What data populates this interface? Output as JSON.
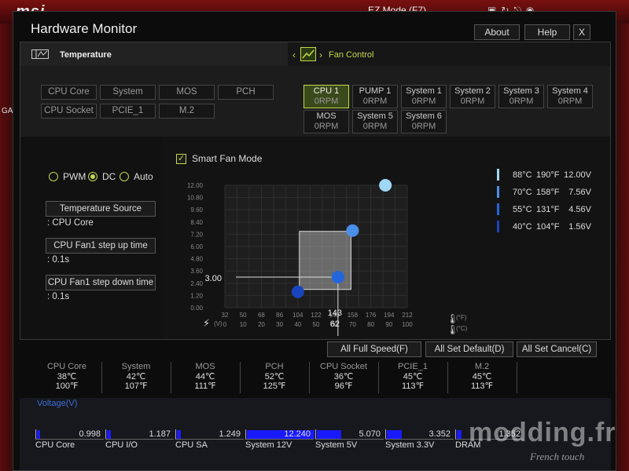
{
  "background": {
    "logo": "msi",
    "ez_mode": "EZ Mode (F7)",
    "side_label": "GA",
    "icons": [
      "f12-icon",
      "refresh-icon",
      "exit-icon",
      "language-icon"
    ]
  },
  "window": {
    "title": "Hardware Monitor",
    "buttons": [
      "About",
      "Help",
      "X"
    ]
  },
  "temperature_header": "Temperature",
  "fan_control_header": "Fan Control",
  "sensors": [
    {
      "label": "CPU Core",
      "active": true
    },
    {
      "label": "System",
      "active": false
    },
    {
      "label": "MOS",
      "active": false
    },
    {
      "label": "PCH",
      "active": false
    },
    {
      "label": "CPU Socket",
      "active": false
    },
    {
      "label": "PCIE_1",
      "active": false
    },
    {
      "label": "M.2",
      "active": false
    }
  ],
  "fans": [
    {
      "name": "CPU 1",
      "rpm": "0RPM",
      "active": true
    },
    {
      "name": "PUMP 1",
      "rpm": "0RPM",
      "active": false
    },
    {
      "name": "System 1",
      "rpm": "0RPM",
      "active": false
    },
    {
      "name": "System 2",
      "rpm": "0RPM",
      "active": false
    },
    {
      "name": "System 3",
      "rpm": "0RPM",
      "active": false
    },
    {
      "name": "System 4",
      "rpm": "0RPM",
      "active": false
    },
    {
      "name": "MOS",
      "rpm": "0RPM",
      "active": false
    },
    {
      "name": "System 5",
      "rpm": "0RPM",
      "active": false
    },
    {
      "name": "System 6",
      "rpm": "0RPM",
      "active": false
    }
  ],
  "mode": {
    "options": [
      "PWM",
      "DC",
      "Auto"
    ],
    "selected": "DC"
  },
  "temperature_source": {
    "label": "Temperature Source",
    "value": ": CPU Core"
  },
  "step_up": {
    "label": "CPU Fan1 step up time",
    "value": ": 0.1s"
  },
  "step_down": {
    "label": "CPU Fan1 step down time",
    "value": ": 0.1s"
  },
  "smart_fan": {
    "label": "Smart Fan Mode",
    "checked": true
  },
  "chart_data": {
    "type": "scatter",
    "y_ticks": [
      "12.00",
      "10.80",
      "9.60",
      "8.40",
      "7.20",
      "6.00",
      "4.80",
      "3.60",
      "2.40",
      "1.20",
      "0.00"
    ],
    "ylim": [
      0,
      12
    ],
    "x_ticks_f": [
      "32",
      "50",
      "68",
      "86",
      "104",
      "122",
      "140",
      "158",
      "176",
      "194",
      "212"
    ],
    "x_ticks_c": [
      "0",
      "10",
      "20",
      "30",
      "40",
      "50",
      "60",
      "70",
      "80",
      "90",
      "100"
    ],
    "xlim": [
      0,
      100
    ],
    "v_unit": "(V)",
    "f_unit": "(°F)",
    "c_unit": "(°C)",
    "points": [
      {
        "x": 40,
        "y": 1.56
      },
      {
        "x": 62,
        "y": 3.0
      },
      {
        "x": 70,
        "y": 7.56
      },
      {
        "x": 88,
        "y": 12.0
      }
    ],
    "marker": {
      "x_c": "62",
      "x_f": "143",
      "y": "3.00"
    },
    "highlight": {
      "x0": 40,
      "x1": 70,
      "y0": 1.56,
      "y1": 7.56
    }
  },
  "legend": [
    {
      "c": "88°C",
      "f": "190°F",
      "v": "12.00V",
      "color": "#9fd8f5"
    },
    {
      "c": "70°C",
      "f": "158°F",
      "v": "7.56V",
      "color": "#4a8fe8"
    },
    {
      "c": "55°C",
      "f": "131°F",
      "v": "4.56V",
      "color": "#2266dd"
    },
    {
      "c": "40°C",
      "f": "104°F",
      "v": "1.56V",
      "color": "#1a44bb"
    }
  ],
  "actions": [
    "All Full Speed(F)",
    "All Set Default(D)",
    "All Set Cancel(C)"
  ],
  "readings": [
    {
      "name": "CPU Core",
      "c": "38℃",
      "f": "100℉"
    },
    {
      "name": "System",
      "c": "42℃",
      "f": "107℉"
    },
    {
      "name": "MOS",
      "c": "44℃",
      "f": "111℉"
    },
    {
      "name": "PCH",
      "c": "52℃",
      "f": "125℉"
    },
    {
      "name": "CPU Socket",
      "c": "36℃",
      "f": "96℉"
    },
    {
      "name": "PCIE_1",
      "c": "45℃",
      "f": "113℉"
    },
    {
      "name": "M.2",
      "c": "45℃",
      "f": "113℉"
    }
  ],
  "voltage": {
    "title": "Voltage(V)",
    "items": [
      {
        "name": "CPU Core",
        "value": "0.998",
        "fill": 0.05
      },
      {
        "name": "CPU I/O",
        "value": "1.187",
        "fill": 0.06
      },
      {
        "name": "CPU SA",
        "value": "1.249",
        "fill": 0.06
      },
      {
        "name": "System 12V",
        "value": "12.240",
        "fill": 1.0
      },
      {
        "name": "System 5V",
        "value": "5.070",
        "fill": 0.36
      },
      {
        "name": "System 3.3V",
        "value": "3.352",
        "fill": 0.22
      },
      {
        "name": "DRAM",
        "value": "1.352",
        "fill": 0.07
      }
    ]
  },
  "watermark": {
    "main": "modding.fr",
    "sub": "French touch"
  }
}
